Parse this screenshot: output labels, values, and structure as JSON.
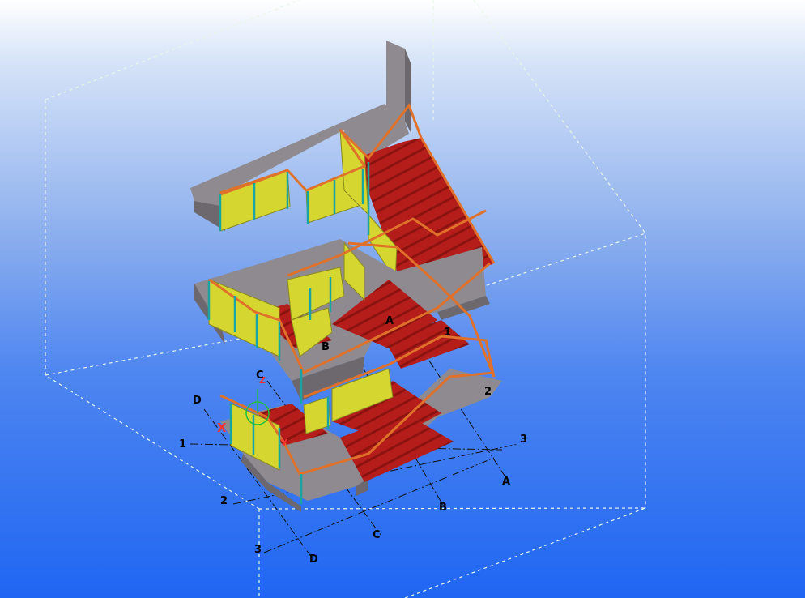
{
  "view": {
    "type": "3D model view"
  },
  "gridlines": {
    "rows": [
      "1",
      "2",
      "3"
    ],
    "columns": [
      "A",
      "B",
      "C",
      "D"
    ]
  },
  "stair_labels": {
    "a": "A",
    "b": "B",
    "c": "C",
    "one": "1",
    "two": "2"
  },
  "axes": {
    "x": "X",
    "y": "Y",
    "z": "Z"
  },
  "colors": {
    "slab": "#8e8a8f",
    "slab_side": "#6c686d",
    "tread": "#b51d1a",
    "tread_dark": "#8a1310",
    "glass": "#d6d630",
    "handrail": "#e0712a",
    "post": "#1aa3a3",
    "work_area_box": "#d8f0d8"
  }
}
